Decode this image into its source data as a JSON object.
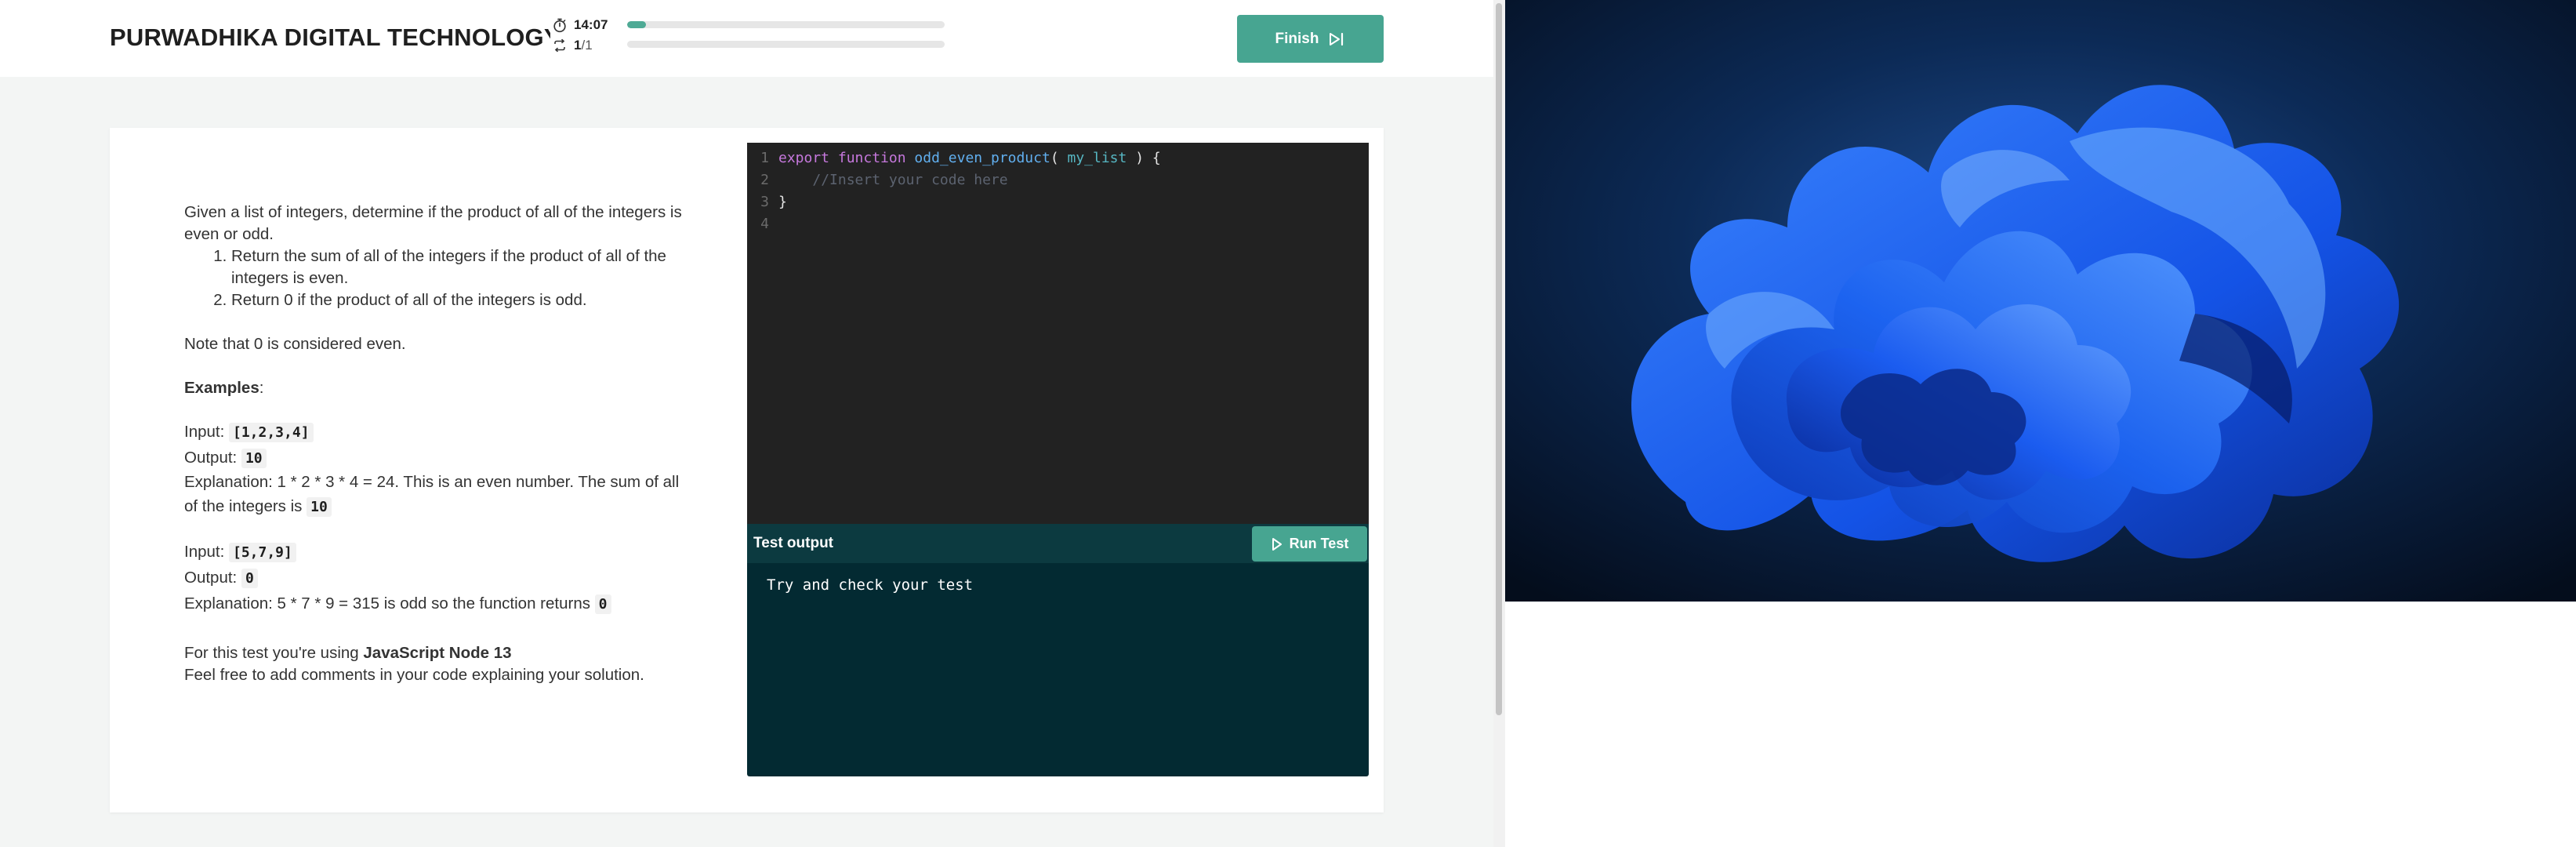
{
  "header": {
    "brand": "PURWADHIKA DIGITAL TECHNOLOGY SCHOOL",
    "timer": "14:07",
    "timer_progress": 0.06,
    "question_current": "1",
    "question_total": "/1",
    "question_progress": 0,
    "finish_label": "Finish"
  },
  "problem": {
    "intro": "Given a list of integers, determine if the product of all of the integers is even or odd.",
    "rules": [
      "Return the sum of all of the integers if the product of all of the integers is even.",
      "Return 0 if the product of all of the integers is odd."
    ],
    "note": "Note that 0 is considered even.",
    "examples_label": "Examples",
    "examples_colon": ":",
    "examples": [
      {
        "input_label": "Input:",
        "input_value": "[1,2,3,4]",
        "output_label": "Output:",
        "output_value": "10",
        "explanation": "Explanation: 1 * 2 * 3 * 4 = 24. This is an even number. The sum of all of the integers is",
        "explanation_value": "10"
      },
      {
        "input_label": "Input:",
        "input_value": "[5,7,9]",
        "output_label": "Output:",
        "output_value": "0",
        "explanation": "Explanation: 5 * 7 * 9 = 315 is odd so the function returns",
        "explanation_value": "0"
      }
    ],
    "runtime_prefix": "For this test you're using",
    "runtime": "JavaScript Node 13",
    "closing": "Feel free to add comments in your code explaining your solution."
  },
  "editor": {
    "line_numbers": [
      "1",
      "2",
      "3",
      "4"
    ],
    "kw_export": "export",
    "kw_function": "function",
    "fn_name": "odd_even_product",
    "open_paren": "(",
    "param": "my_list",
    "close_sig": ") {",
    "comment": "//Insert your code here",
    "close_brace": "}"
  },
  "output": {
    "title": "Test output",
    "run_label": "Run Test",
    "text": "Try and check your test"
  },
  "colors": {
    "accent": "#47a591",
    "editor_bg": "#222222",
    "output_bg": "#032a32",
    "output_header_bg": "#0c3a40"
  }
}
